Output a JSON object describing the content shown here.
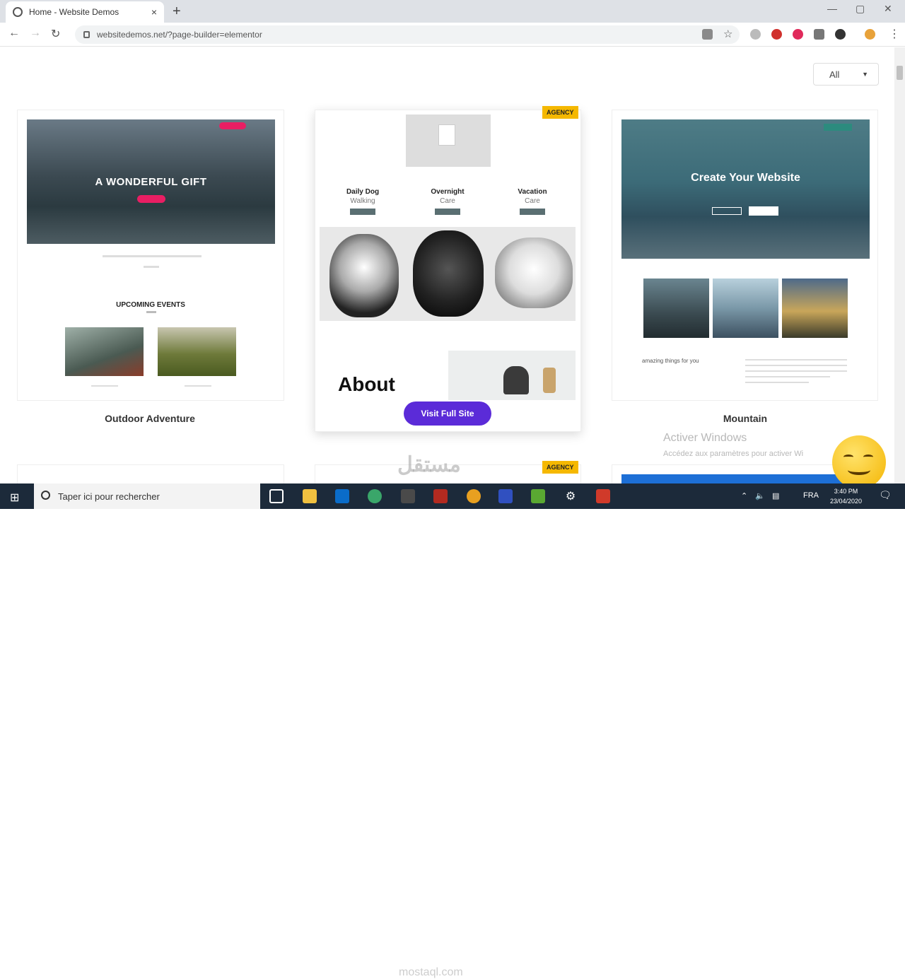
{
  "browser": {
    "tab_title": "Home - Website Demos",
    "url": "websitedemos.net/?page-builder=elementor",
    "new_tab": "+",
    "close_tab": "×",
    "minimize": "—",
    "maximize": "▢",
    "close_window": "✕"
  },
  "page": {
    "filter": {
      "value": "All",
      "arrow": "▼"
    },
    "cards": [
      {
        "name": "Outdoor Adventure",
        "hero_text": "A WONDERFUL GIFT",
        "section_title": "UPCOMING EVENTS"
      },
      {
        "badge": "AGENCY",
        "services": [
          {
            "line1": "Daily Dog",
            "line2": "Walking"
          },
          {
            "line1": "Overnight",
            "line2": "Care"
          },
          {
            "line1": "Vacation",
            "line2": "Care"
          }
        ],
        "about": "About",
        "visit_button": "Visit Full Site"
      },
      {
        "name": "Mountain",
        "hero_text": "Create Your Website",
        "tagline": "amazing things for you"
      }
    ],
    "second_row_badge": "AGENCY"
  },
  "overlay": {
    "activate_title": "Activer Windows",
    "activate_sub": "Accédez aux paramètres pour activer Wi",
    "watermark_ar": "مستقل",
    "watermark_en": "mostaql.com"
  },
  "taskbar": {
    "search_placeholder": "Taper ici pour rechercher",
    "language": "FRA",
    "time": "3:40 PM",
    "date": "23/04/2020"
  },
  "colors": {
    "visit_button": "#5b2bd8",
    "badge": "#f5b800",
    "taskbar": "#1c2a3a"
  }
}
